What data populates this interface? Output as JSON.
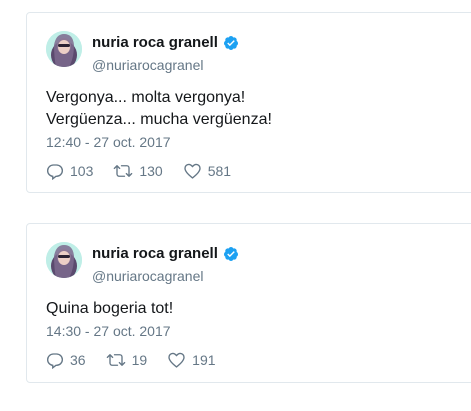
{
  "tweets": [
    {
      "author_name": "nuria roca granell",
      "handle": "@nuriarocagranel",
      "text_lines": [
        "Vergonya... molta vergonya!",
        "Vergüenza... mucha vergüenza!"
      ],
      "timestamp": "12:40 - 27 oct. 2017",
      "replies": "103",
      "retweets": "130",
      "likes": "581"
    },
    {
      "author_name": "nuria roca granell",
      "handle": "@nuriarocagranel",
      "text_lines": [
        "Quina bogeria tot!"
      ],
      "timestamp": "14:30 - 27 oct. 2017",
      "replies": "36",
      "retweets": "19",
      "likes": "191"
    }
  ],
  "icons": {
    "verified": "verified-badge-icon",
    "reply": "reply-icon",
    "retweet": "retweet-icon",
    "like": "heart-icon"
  },
  "colors": {
    "verified_blue": "#1da1f2",
    "secondary_text": "#657786",
    "border": "#e1e8ed"
  }
}
